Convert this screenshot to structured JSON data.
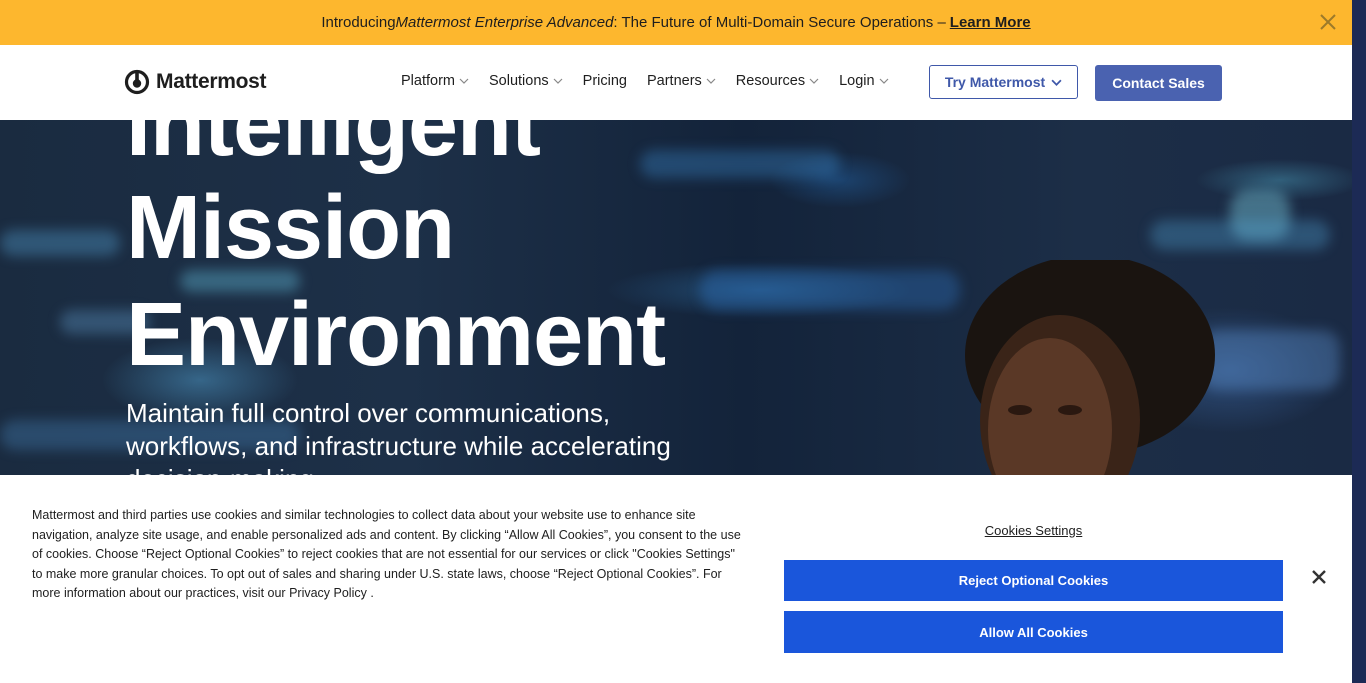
{
  "announcement": {
    "prefix": "Introducing ",
    "product": "Mattermost Enterprise Advanced",
    "suffix": ": The Future of Multi-Domain Secure Operations –",
    "link": "Learn More"
  },
  "header": {
    "logo_text": "Mattermost",
    "nav": [
      {
        "label": "Platform",
        "has_dropdown": true
      },
      {
        "label": "Solutions",
        "has_dropdown": true
      },
      {
        "label": "Pricing",
        "has_dropdown": false
      },
      {
        "label": "Partners",
        "has_dropdown": true
      },
      {
        "label": "Resources",
        "has_dropdown": true
      },
      {
        "label": "Login",
        "has_dropdown": true
      }
    ],
    "try_button": "Try Mattermost",
    "contact_button": "Contact Sales"
  },
  "hero": {
    "title_lines": [
      "Intelligent",
      "Mission",
      "Environment"
    ],
    "subtitle": "Maintain full control over communications, workflows, and infrastructure while accelerating decision-making."
  },
  "cookie_banner": {
    "text": "Mattermost and third parties use cookies and similar technologies to collect data about your website use to enhance site navigation, analyze site usage, and enable personalized ads and content. By clicking “Allow All Cookies”, you consent to the use of cookies. Choose “Reject Optional Cookies” to reject cookies that are not essential for our services or click \"Cookies Settings\" to make more granular choices. To opt out of sales and sharing under U.S. state laws, choose “Reject Optional Cookies”. For more information about our practices, visit our ",
    "privacy_link": "Privacy Policy",
    "text_end": " .",
    "settings_link": "Cookies Settings",
    "reject_button": "Reject Optional Cookies",
    "allow_button": "Allow All Cookies"
  },
  "colors": {
    "announcement_bg": "#fdb72e",
    "primary_button": "#4a62b0",
    "cookie_button": "#1a56db",
    "hero_bg": "#1b2d44"
  },
  "icons": [
    "close-icon",
    "mattermost-logo-icon",
    "chevron-down-icon"
  ]
}
